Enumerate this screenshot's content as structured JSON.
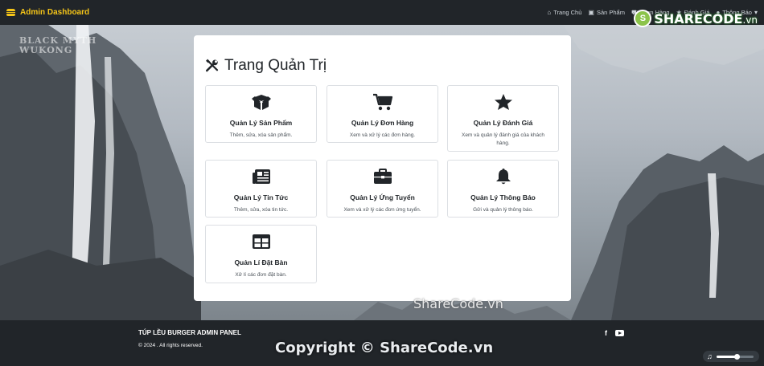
{
  "navbar": {
    "brand": "Admin Dashboard",
    "links": [
      {
        "label": "Trang Chủ",
        "icon": "home-icon"
      },
      {
        "label": "Sản Phẩm",
        "icon": "box-icon"
      },
      {
        "label": "Đơn Hàng",
        "icon": "cart-icon"
      },
      {
        "label": "Đánh Giá",
        "icon": "star-icon"
      },
      {
        "label": "Thông Báo",
        "icon": "bell-icon"
      }
    ]
  },
  "watermark": {
    "logo_letter": "S",
    "logo_text": "SHARECODE",
    "logo_domain": ".vn",
    "middle": "ShareCode.vn",
    "copyright": "Copyright © ShareCode.vn"
  },
  "background": {
    "caption_line1": "BLACK MYTH",
    "caption_line2": "WUKONG"
  },
  "panel": {
    "title": "Trang Quản Trị",
    "cards": [
      {
        "title": "Quản Lý Sản Phẩm",
        "desc": "Thêm, sửa, xóa sản phẩm.",
        "icon": "box-open-icon"
      },
      {
        "title": "Quản Lý Đơn Hàng",
        "desc": "Xem và xử lý các đơn hàng.",
        "icon": "shopping-cart-icon"
      },
      {
        "title": "Quản Lý Đánh Giá",
        "desc": "Xem và quản lý đánh giá của khách hàng.",
        "icon": "star-icon"
      },
      {
        "title": "Quản Lý Tin Tức",
        "desc": "Thêm, sửa, xóa tin tức.",
        "icon": "newspaper-icon"
      },
      {
        "title": "Quản Lý Ứng Tuyển",
        "desc": "Xem và xử lý các đơn ứng tuyển.",
        "icon": "briefcase-icon"
      },
      {
        "title": "Quản Lý Thông Báo",
        "desc": "Gửi và quản lý thông báo.",
        "icon": "bell-icon"
      },
      {
        "title": "Quản Lí Đặt Bàn",
        "desc": "Xử lí các đơn đặt bàn.",
        "icon": "table-icon"
      }
    ]
  },
  "footer": {
    "title": "TÚP LỀU BURGER ADMIN PANEL",
    "copyright": "© 2024 . All rights reserved.",
    "social": [
      {
        "icon": "facebook-icon",
        "glyph": "f"
      },
      {
        "icon": "youtube-icon"
      }
    ]
  },
  "music_player": {
    "icon": "music-note-icon",
    "volume": 0.55
  },
  "colors": {
    "navbar": "#212529",
    "brand": "#f5c518",
    "panel": "#ffffff",
    "footer": "#212529"
  }
}
